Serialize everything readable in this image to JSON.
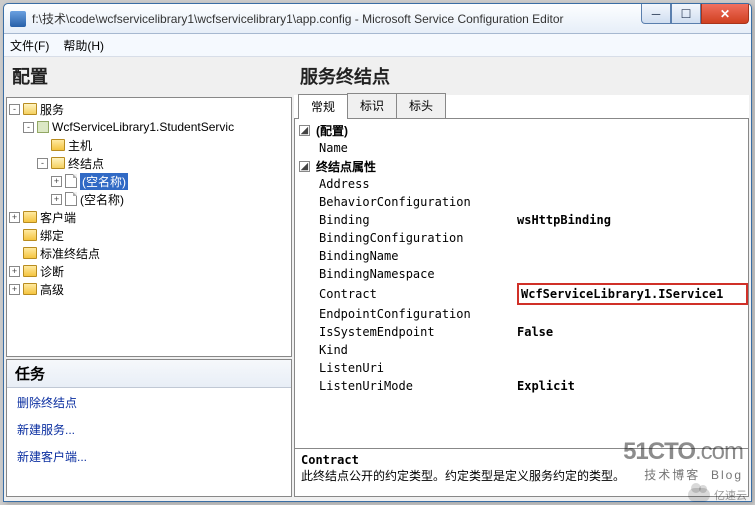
{
  "window": {
    "title": "f:\\技术\\code\\wcfservicelibrary1\\wcfservicelibrary1\\app.config - Microsoft Service Configuration Editor"
  },
  "menu": {
    "file": "文件(F)",
    "help": "帮助(H)"
  },
  "left": {
    "header": "配置",
    "tree": {
      "services": "服务",
      "svc1": "WcfServiceLibrary1.StudentServic",
      "host": "主机",
      "endpoints": "终结点",
      "empty": "(空名称)",
      "client": "客户端",
      "binding": "绑定",
      "stdendpoints": "标准终结点",
      "diag": "诊断",
      "adv": "高级"
    },
    "tasks": {
      "header": "任务",
      "delete_ep": "删除终结点",
      "new_service": "新建服务...",
      "new_client": "新建客户端..."
    }
  },
  "right": {
    "header": "服务终结点",
    "tabs": {
      "general": "常规",
      "id": "标识",
      "header2": "标头"
    },
    "cats": {
      "config": "(配置)",
      "epattrs": "终结点属性"
    },
    "props": {
      "Name": "Name",
      "Address": "Address",
      "BehaviorConfiguration": "BehaviorConfiguration",
      "Binding": "Binding",
      "BindingConfiguration": "BindingConfiguration",
      "BindingName": "BindingName",
      "BindingNamespace": "BindingNamespace",
      "Contract": "Contract",
      "EndpointConfiguration": "EndpointConfiguration",
      "IsSystemEndpoint": "IsSystemEndpoint",
      "Kind": "Kind",
      "ListenUri": "ListenUri",
      "ListenUriMode": "ListenUriMode"
    },
    "vals": {
      "Binding": "wsHttpBinding",
      "Contract": "WcfServiceLibrary1.IService1",
      "IsSystemEndpoint": "False",
      "ListenUriMode": "Explicit"
    },
    "help": {
      "name": "Contract",
      "desc": "此终结点公开的约定类型。约定类型是定义服务约定的类型。"
    }
  },
  "watermark": {
    "big1": "51CTO",
    "big2": ".com",
    "sub": "技术博客",
    "sub2": "Blog",
    "brand": "亿速云"
  }
}
